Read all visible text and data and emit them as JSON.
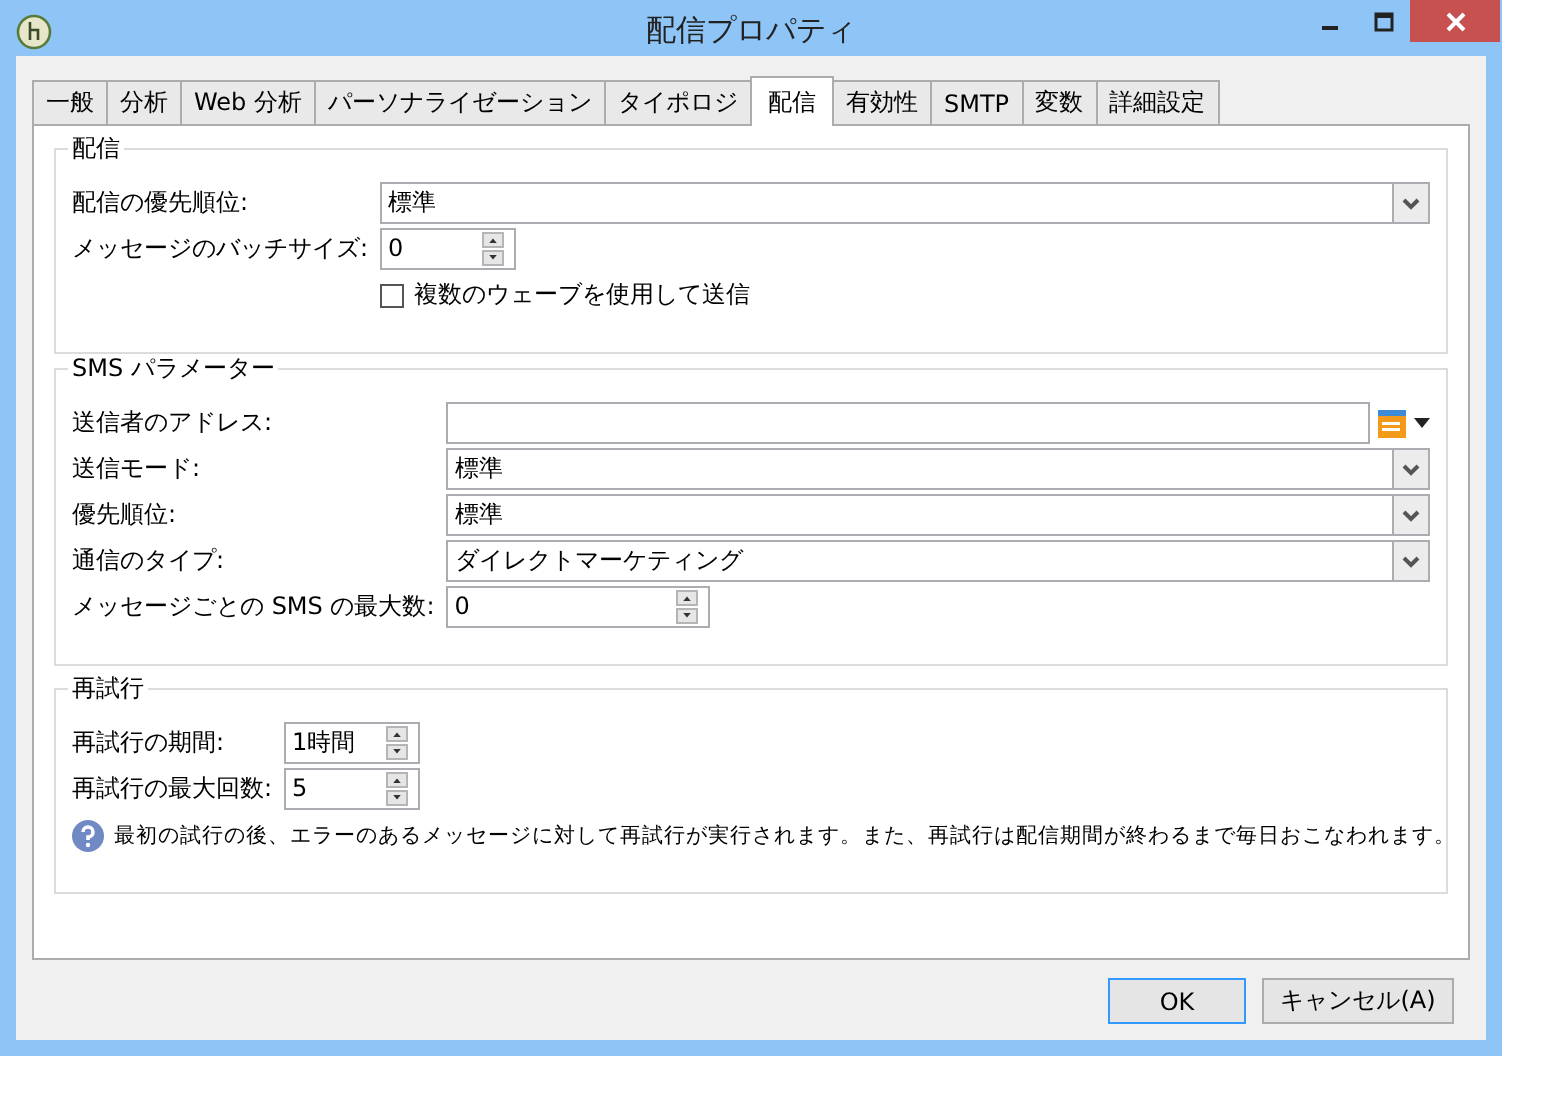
{
  "window": {
    "title": "配信プロパティ"
  },
  "tabs": [
    {
      "label": "一般",
      "selected": false
    },
    {
      "label": "分析",
      "selected": false
    },
    {
      "label": "Web 分析",
      "selected": false
    },
    {
      "label": "パーソナライゼーション",
      "selected": false
    },
    {
      "label": "タイポロジ",
      "selected": false
    },
    {
      "label": "配信",
      "selected": true
    },
    {
      "label": "有効性",
      "selected": false
    },
    {
      "label": "SMTP",
      "selected": false
    },
    {
      "label": "変数",
      "selected": false
    },
    {
      "label": "詳細設定",
      "selected": false
    }
  ],
  "groups": [
    {
      "title": "配信",
      "fields": [
        {
          "kind": "combo",
          "label": "配信の優先順位:",
          "value": "標準"
        },
        {
          "kind": "spin",
          "label": "メッセージのバッチサイズ:",
          "value": "0"
        },
        {
          "kind": "check",
          "label": "複数のウェーブを使用して送信",
          "checked": false
        }
      ]
    },
    {
      "title": "SMS パラメーター",
      "fields": [
        {
          "kind": "address",
          "label": "送信者のアドレス:"
        },
        {
          "kind": "combo",
          "label": "送信モード:",
          "value": "標準"
        },
        {
          "kind": "combo",
          "label": "優先順位:",
          "value": "標準"
        },
        {
          "kind": "combo",
          "label": "通信のタイプ:",
          "value": "ダイレクトマーケティング"
        },
        {
          "kind": "widespin",
          "label": "メッセージごとの SMS の最大数:",
          "value": "0"
        }
      ]
    },
    {
      "title": "再試行",
      "fields": [
        {
          "kind": "spin",
          "label": "再試行の期間:",
          "value": "1時間"
        },
        {
          "kind": "spin",
          "label": "再試行の最大回数:",
          "value": "5"
        },
        {
          "kind": "info",
          "text": "最初の試行の後、エラーのあるメッセージに対して再試行が実行されます。また、再試行は配信期間が終わるまで毎日おこなわれます。"
        }
      ]
    }
  ],
  "buttons": [
    {
      "label": "OK",
      "default": true
    },
    {
      "label": "キャンセル(A)",
      "default": false
    }
  ]
}
